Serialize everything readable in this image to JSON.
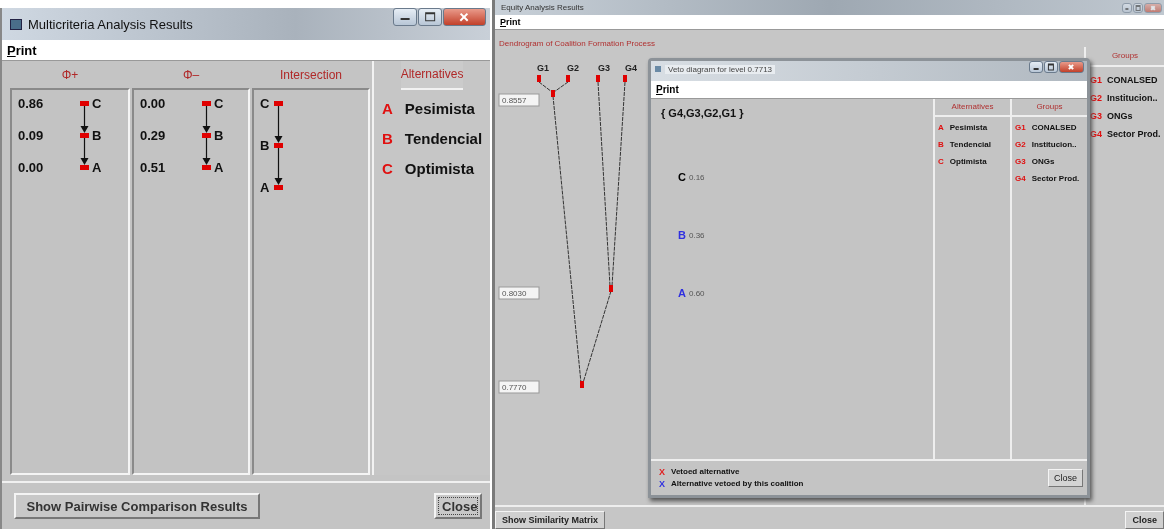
{
  "multicriteria_window": {
    "title": "Multicriteria Analysis Results",
    "menu": [
      "Print"
    ],
    "rankings": [
      {
        "header": "Φ+",
        "rows": [
          {
            "value": "0.86",
            "letter": "C"
          },
          {
            "value": "0.09",
            "letter": "B"
          },
          {
            "value": "0.00",
            "letter": "A"
          }
        ]
      },
      {
        "header": "Φ–",
        "rows": [
          {
            "value": "0.00",
            "letter": "C"
          },
          {
            "value": "0.29",
            "letter": "B"
          },
          {
            "value": "0.51",
            "letter": "A"
          }
        ]
      }
    ],
    "intersection": {
      "header": "Intersection",
      "order": [
        "C",
        "B",
        "A"
      ]
    },
    "alternatives": {
      "header": "Alternatives",
      "items": [
        {
          "code": "A",
          "name": "Pesimista"
        },
        {
          "code": "B",
          "name": "Tendencial"
        },
        {
          "code": "C",
          "name": "Optimista"
        }
      ]
    },
    "buttons": [
      "Show Pairwise Comparison Results",
      "Close"
    ]
  },
  "equity_window": {
    "title": "Equity Analysis Results",
    "menu": [
      "Print"
    ],
    "subtitle": "Dendrogram of Coalition Formation Process",
    "dendrogram": {
      "leaves": [
        "G1",
        "G2",
        "G3",
        "G4"
      ],
      "levels": [
        "0.8557",
        "0.8030",
        "0.7770"
      ]
    },
    "groups": {
      "header": "Groups",
      "items": [
        {
          "code": "G1",
          "name": "CONALSED"
        },
        {
          "code": "G2",
          "name": "Institucion.."
        },
        {
          "code": "G3",
          "name": "ONGs"
        },
        {
          "code": "G4",
          "name": "Sector Prod."
        }
      ]
    },
    "buttons": [
      "Show Similarity Matrix",
      "Close"
    ]
  },
  "veto_dialog": {
    "title": "Veto diagram for level 0.7713",
    "menu": [
      "Print"
    ],
    "coalition": "{ G4,G3,G2,G1 }",
    "scores": [
      {
        "letter": "C",
        "score": "0.16",
        "color": "#000000"
      },
      {
        "letter": "B",
        "score": "0.36",
        "color": "#3030e0"
      },
      {
        "letter": "A",
        "score": "0.60",
        "color": "#3030e0"
      }
    ],
    "alternatives": {
      "header": "Alternatives",
      "items": [
        {
          "code": "A",
          "name": "Pesimista"
        },
        {
          "code": "B",
          "name": "Tendencial"
        },
        {
          "code": "C",
          "name": "Optimista"
        }
      ]
    },
    "groups": {
      "header": "Groups",
      "items": [
        {
          "code": "G1",
          "name": "CONALSED"
        },
        {
          "code": "G2",
          "name": "Institucion.."
        },
        {
          "code": "G3",
          "name": "ONGs"
        },
        {
          "code": "G4",
          "name": "Sector Prod."
        }
      ]
    },
    "legend": [
      {
        "mark": "X",
        "text": "Vetoed alternative",
        "color": "#e02020"
      },
      {
        "mark": "X",
        "text": "Alternative vetoed by this coalition",
        "color": "#3030e0"
      }
    ],
    "buttons": [
      "Close"
    ]
  }
}
